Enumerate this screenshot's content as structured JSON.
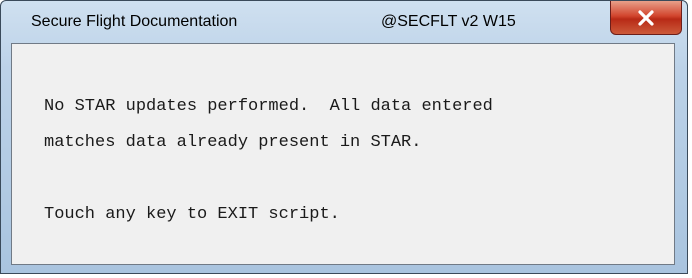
{
  "window": {
    "title": "Secure Flight Documentation",
    "tag": "@SECFLT v2 W15",
    "close_icon": "close-x-icon"
  },
  "message": {
    "line1": "No STAR updates performed.  All data entered",
    "line2": "matches data already present in STAR.",
    "line3": "Touch any key to EXIT script."
  },
  "colors": {
    "titlebar": "#bcd2e8",
    "close_button": "#c8412a",
    "client_background": "#f0f0f0"
  }
}
